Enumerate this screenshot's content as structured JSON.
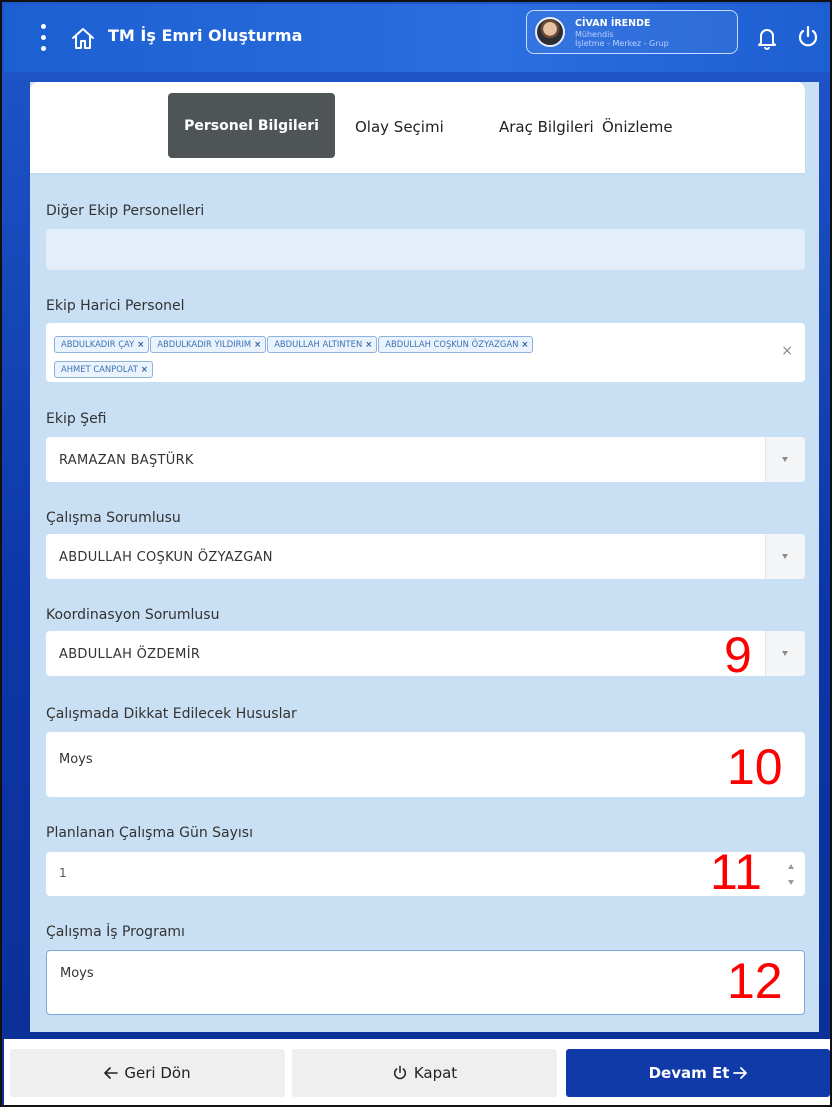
{
  "header": {
    "title": "TM İş Emri Oluşturma",
    "user": {
      "name": "CİVAN İRENDE",
      "role": "Mühendis",
      "org": "İşletme - Merkez - Grup"
    }
  },
  "tabs": [
    {
      "label": "Personel Bilgileri",
      "active": true
    },
    {
      "label": "Olay Seçimi",
      "active": false
    },
    {
      "label": "Araç Bilgileri",
      "active": false
    },
    {
      "label": "Önizleme",
      "active": false
    }
  ],
  "form": {
    "other_team": {
      "label": "Diğer Ekip Personelleri",
      "value": ""
    },
    "external": {
      "label": "Ekip Harici Personel",
      "chips": [
        "ABDULKADIR ÇAY",
        "ABDULKADIR YILDIRIM",
        "ABDULLAH ALTINTEN",
        "ABDULLAH COŞKUN ÖZYAZGAN",
        "AHMET CANPOLAT"
      ],
      "chip_remove": "×",
      "clear": "×"
    },
    "team_chief": {
      "label": "Ekip Şefi",
      "value": "RAMAZAN BAŞTÜRK"
    },
    "work_responsible": {
      "label": "Çalışma Sorumlusu",
      "value": "ABDULLAH COŞKUN ÖZYAZGAN"
    },
    "coordination": {
      "label": "Koordinasyon Sorumlusu",
      "value": "ABDULLAH ÖZDEMİR"
    },
    "attention": {
      "label": "Çalışmada Dikkat Edilecek Hususlar",
      "value": "Moys"
    },
    "days": {
      "label": "Planlanan Çalışma Gün Sayısı",
      "value": "1"
    },
    "program": {
      "label": "Çalışma İş Programı",
      "value": "Moys"
    }
  },
  "annotations": [
    "9",
    "10",
    "11",
    "12"
  ],
  "footer": {
    "back": "Geri Dön",
    "close": "Kapat",
    "next": "Devam Et"
  },
  "colors": {
    "primary": "#0f3aa8",
    "header": "#1f60d2",
    "panel_bg": "#c9dff3",
    "active_tab": "#4f5457",
    "chip_border": "#8db2dc",
    "annotation": "#ff0000"
  },
  "icons": [
    "menu-icon",
    "home-icon",
    "bell-icon",
    "power-icon",
    "arrow-left-icon",
    "arrow-right-icon"
  ]
}
